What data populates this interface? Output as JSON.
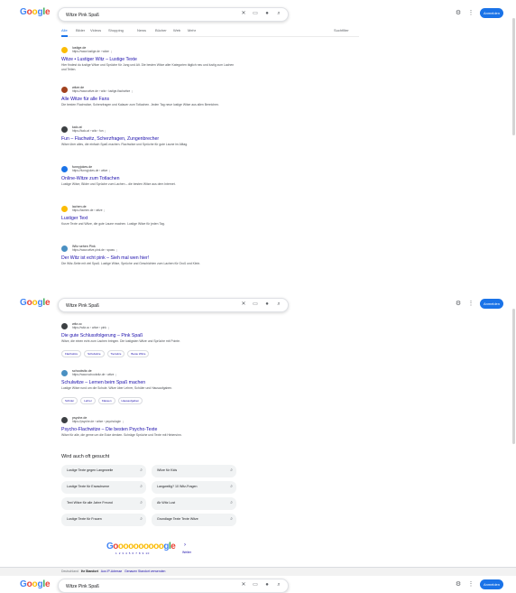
{
  "query": "Witze Pink Spaß",
  "logo": "Google",
  "header": {
    "signin": "Anmelden"
  },
  "tabs": [
    "Alle",
    "Bilder",
    "Videos",
    "Shopping",
    "News",
    "Bücher",
    "Web",
    "Mehr"
  ],
  "tools": "Suchfilter",
  "results_top": [
    {
      "site": "lustige.de",
      "url": "https://www.lustige.de › witze",
      "title": "Witze • Lustiger Witz – Lustige Texte",
      "snippet": "Hier findest du lustige Witze und Sprüche für Jung und Alt. Die besten Witze aller Kategorien täglich neu und lustig zum Lachen und Teilen.",
      "color": "#fbbc05"
    },
    {
      "site": "witze.de",
      "url": "https://www.witze.de › witz › lustige-flachwitze",
      "title": "Alle Witze für alle Fans",
      "snippet": "Die besten Flachwitze, Scherzfragen und Kalauer zum Totlachen. Jeden Tag neue lustige Witze aus allen Bereichen.",
      "color": "#a1421e"
    },
    {
      "site": "kalo.at",
      "url": "https://kalo.at › witz › fun",
      "title": "Fun – Flachwitz, Scherzfragen, Zungenbrecher",
      "snippet": "Witze über alles, die einfach Spaß machen. Flachwitze und Sprüche für gute Laune im Alltag.",
      "color": "#3c4043"
    },
    {
      "site": "funnyjokes.de",
      "url": "https://funnyjokes.de › witze",
      "title": "Online-Witze zum Totlachen",
      "snippet": "Lustige Witze, Bilder und Sprüche zum Lachen – die besten Witze aus dem Internet.",
      "color": "#1a73e8"
    },
    {
      "site": "lachen.de",
      "url": "https://lachen.de › witze",
      "title": "Lustiger Text",
      "snippet": "Kurze Texte und Witze, die gute Laune machen. Lustige Witze für jeden Tag.",
      "color": "#fbbc05"
    },
    {
      "site": "Witz sehen Pink",
      "url": "https://www.witze-pink.de › spass",
      "title": "Der Witz ist echt pink – Sieh mal wen hier!",
      "snippet": "Die Witz-Seite mit viel Spaß. Lustige Witze, Sprüche und Geschichten zum Lachen für Groß und Klein.",
      "color": "#4a90c2"
    }
  ],
  "results_mid": [
    {
      "site": "witz.cc",
      "url": "https://witz.cc › witze › pink",
      "title": "Die gute Schlussfolgerung – Pink Spaß",
      "snippet": "Witze, die einen echt zum Lachen bringen. Die lustigsten Witze und Sprüche mit Pointe.",
      "color": "#3c4043",
      "chips": [
        "Flachwitze",
        "Schulwitze",
        "Tierwitze",
        "Beste Witze"
      ]
    },
    {
      "site": "schoolwitz.de",
      "url": "https://www.schoolwitz.de › witze",
      "title": "Schulwitze – Lernen beim Spaß machen",
      "snippet": "Lustige Witze rund um die Schule. Witze über Lehrer, Schüler und Hausaufgaben.",
      "color": "#4a90c2",
      "chips": [
        "Schüler",
        "Lehrer",
        "Klassen",
        "Hausaufgaben"
      ]
    },
    {
      "site": "psyche.de",
      "url": "https://psyche.de › witze › psychologie",
      "title": "Psycho-Flachwitze – Die besten Psycho-Texte",
      "snippet": "Witze für alle, die gerne um die Ecke denken. Schräge Sprüche und Texte mit Hintersinn.",
      "color": "#3c4043",
      "chips": []
    }
  ],
  "related": {
    "title": "Wird auch oft gesucht",
    "items": [
      "Lustige Texte gegen Langeweile",
      "Witze für Kids",
      "Lustige Texte für Erwachsene",
      "Langweilig? 10 Witz-Fragen",
      "Text Witze für alle Jahre Freund",
      "Ab Witz Lust",
      "Lustige Texte für Frauen",
      "Grundlage Texte Texte Witze"
    ]
  },
  "pager": {
    "logo_letters": [
      "G",
      "o",
      "o",
      "o",
      "o",
      "o",
      "o",
      "o",
      "o",
      "o",
      "o",
      "g",
      "l",
      "e"
    ],
    "numbers": "1 2 3 4 5 6 7 8 9 10",
    "next_arrow": "›",
    "next_label": "Weiter"
  },
  "footer": {
    "country": "Deutschland",
    "location": "Ihr Standort",
    "links": [
      "Aus IP-Adresse",
      "Genauen Standort verwenden"
    ]
  }
}
